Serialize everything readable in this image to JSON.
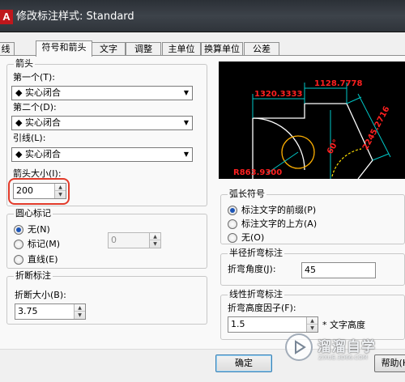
{
  "window": {
    "title": "修改标注样式: Standard",
    "app_icon_letter": "A"
  },
  "tabs": [
    {
      "label": "线",
      "active": false
    },
    {
      "label": "符号和箭头",
      "active": true
    },
    {
      "label": "文字",
      "active": false
    },
    {
      "label": "调整",
      "active": false
    },
    {
      "label": "主单位",
      "active": false
    },
    {
      "label": "换算单位",
      "active": false
    },
    {
      "label": "公差",
      "active": false
    }
  ],
  "arrowheads": {
    "group_title": "箭头",
    "first_label": "第一个(T):",
    "first_value": "实心闭合",
    "second_label": "第二个(D):",
    "second_value": "实心闭合",
    "leader_label": "引线(L):",
    "leader_value": "实心闭合",
    "size_label": "箭头大小(I):",
    "size_value": "200"
  },
  "center_marks": {
    "group_title": "圆心标记",
    "options": [
      {
        "label": "无(N)",
        "selected": true
      },
      {
        "label": "标记(M)",
        "selected": false
      },
      {
        "label": "直线(E)",
        "selected": false
      }
    ],
    "size_value": "0"
  },
  "dimension_break": {
    "group_title": "折断标注",
    "size_label": "折断大小(B):",
    "size_value": "3.75"
  },
  "preview": {
    "dim_top": "1128.7778",
    "dim_left": "1320.3333",
    "dim_diag": "2245.2716",
    "dim_angle": "60°",
    "dim_radius": "R863.9300",
    "colors": {
      "line": "#00c8c8",
      "text": "#ff2020",
      "shape": "#ffffff",
      "circle": "#ffb000",
      "arc": "#ffe000"
    }
  },
  "arc_length_symbol": {
    "group_title": "弧长符号",
    "options": [
      {
        "label": "标注文字的前缀(P)",
        "selected": true
      },
      {
        "label": "标注文字的上方(A)",
        "selected": false
      },
      {
        "label": "无(O)",
        "selected": false
      }
    ]
  },
  "radius_jog": {
    "group_title": "半径折弯标注",
    "angle_label": "折弯角度(J):",
    "angle_value": "45"
  },
  "linear_jog": {
    "group_title": "线性折弯标注",
    "factor_label": "折弯高度因子(F):",
    "factor_value": "1.5",
    "suffix": "* 文字高度"
  },
  "buttons": {
    "ok": "确定",
    "help": "帮助(H)"
  },
  "watermark": {
    "text": "溜溜自学",
    "sub": "ZIXUE.3D66.COM"
  }
}
